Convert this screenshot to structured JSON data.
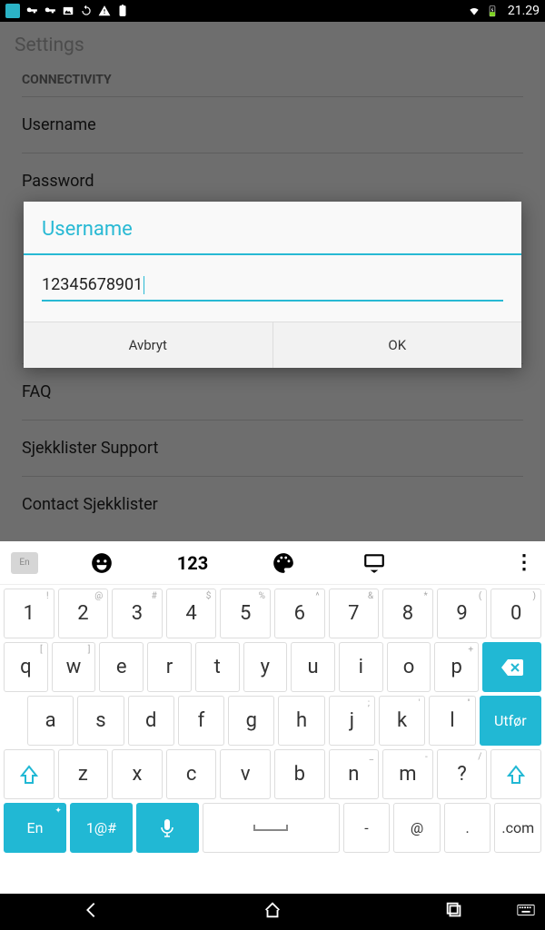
{
  "status": {
    "clock": "21.29"
  },
  "page": {
    "title": "Settings",
    "section": "CONNECTIVITY",
    "items": [
      "Username",
      "Password",
      "FAQ",
      "Sjekklister Support",
      "Contact Sjekklister"
    ]
  },
  "dialog": {
    "title": "Username",
    "value": "12345678901",
    "cancel": "Avbryt",
    "ok": "OK"
  },
  "keyboard": {
    "lang_chip": "En",
    "toolbar_123": "123",
    "row1": [
      {
        "k": "1",
        "s": "!"
      },
      {
        "k": "2",
        "s": "@"
      },
      {
        "k": "3",
        "s": "#"
      },
      {
        "k": "4",
        "s": "$"
      },
      {
        "k": "5",
        "s": "%"
      },
      {
        "k": "6",
        "s": "^"
      },
      {
        "k": "7",
        "s": "&"
      },
      {
        "k": "8",
        "s": "*"
      },
      {
        "k": "9",
        "s": "("
      },
      {
        "k": "0",
        "s": ")"
      }
    ],
    "row2": [
      {
        "k": "q",
        "s": "["
      },
      {
        "k": "w",
        "s": "]"
      },
      {
        "k": "e",
        "s": ""
      },
      {
        "k": "r",
        "s": ""
      },
      {
        "k": "t",
        "s": ""
      },
      {
        "k": "y",
        "s": ""
      },
      {
        "k": "u",
        "s": ""
      },
      {
        "k": "i",
        "s": ""
      },
      {
        "k": "o",
        "s": ""
      },
      {
        "k": "p",
        "s": "+"
      }
    ],
    "row3": [
      {
        "k": "a",
        "s": ""
      },
      {
        "k": "s",
        "s": ""
      },
      {
        "k": "d",
        "s": ""
      },
      {
        "k": "f",
        "s": ""
      },
      {
        "k": "g",
        "s": ""
      },
      {
        "k": "h",
        "s": ""
      },
      {
        "k": "j",
        "s": ";"
      },
      {
        "k": "k",
        "s": "'"
      },
      {
        "k": "l",
        "s": "\""
      }
    ],
    "row4": [
      {
        "k": "z",
        "s": ""
      },
      {
        "k": "x",
        "s": ""
      },
      {
        "k": "c",
        "s": ""
      },
      {
        "k": "v",
        "s": ""
      },
      {
        "k": "b",
        "s": ""
      },
      {
        "k": "n",
        "s": "_"
      },
      {
        "k": "m",
        "s": "-"
      },
      {
        "k": "?",
        "s": "/"
      }
    ],
    "action": "Utfør",
    "bottom": {
      "lang": "En",
      "sym": "1@#",
      "dash": "-",
      "at": "@",
      "dot": ".",
      "com": ".com"
    }
  }
}
